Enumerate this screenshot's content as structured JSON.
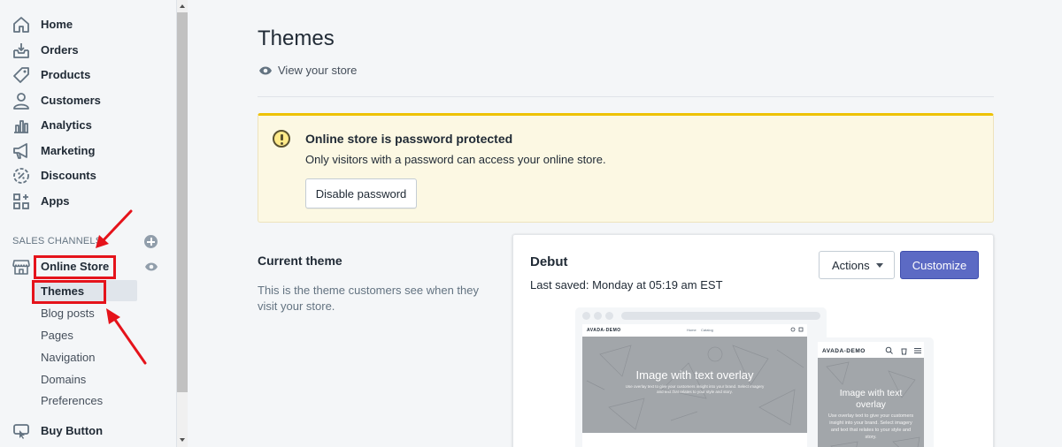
{
  "sidebar": {
    "items": [
      {
        "label": "Home",
        "icon": "home-icon"
      },
      {
        "label": "Orders",
        "icon": "orders-icon"
      },
      {
        "label": "Products",
        "icon": "tag-icon"
      },
      {
        "label": "Customers",
        "icon": "person-icon"
      },
      {
        "label": "Analytics",
        "icon": "bar-chart-icon"
      },
      {
        "label": "Marketing",
        "icon": "megaphone-icon"
      },
      {
        "label": "Discounts",
        "icon": "discount-icon"
      },
      {
        "label": "Apps",
        "icon": "apps-icon"
      }
    ],
    "sales_channels_heading": "SALES CHANNELS",
    "online_store": {
      "label": "Online Store",
      "icon": "store-icon"
    },
    "sub_items": [
      {
        "label": "Themes"
      },
      {
        "label": "Blog posts"
      },
      {
        "label": "Pages"
      },
      {
        "label": "Navigation"
      },
      {
        "label": "Domains"
      },
      {
        "label": "Preferences"
      }
    ],
    "buy_button": {
      "label": "Buy Button",
      "icon": "buy-button-icon"
    }
  },
  "header": {
    "title": "Themes",
    "view_store_label": "View your store"
  },
  "banner": {
    "title": "Online store is password protected",
    "text": "Only visitors with a password can access your online store.",
    "button_label": "Disable password"
  },
  "current_theme": {
    "heading": "Current theme",
    "description": "This is the theme customers see when they visit your store.",
    "name": "Debut",
    "last_saved": "Last saved: Monday at 05:19 am EST",
    "actions_label": "Actions",
    "customize_label": "Customize"
  },
  "preview": {
    "brand": "AVADA-DEMO",
    "nav_links": [
      "Home",
      "Catalog"
    ],
    "hero_title": "Image with text overlay",
    "hero_sub_desktop": "Use overlay text to give your customers insight into your brand. Select imagery and text that relates to your style and story.",
    "hero_sub_mobile": "Use overlay text to give your customers insight into your brand. Select imagery and text that relates to your style and story."
  },
  "colors": {
    "accent": "#5c6ac4",
    "annotation_red": "#e5131b",
    "warning_bar": "#eec200",
    "warning_bg": "#fcf8e3"
  }
}
